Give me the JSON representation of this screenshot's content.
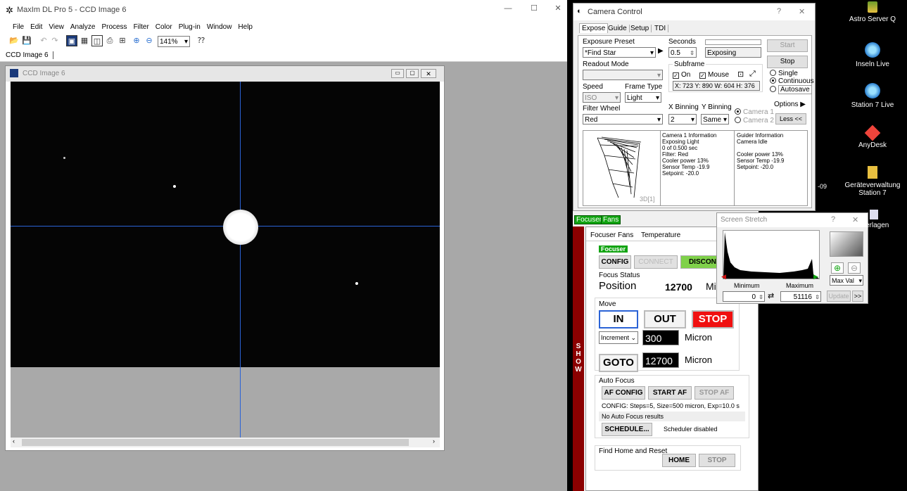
{
  "maxim": {
    "title": "MaxIm DL Pro 5 - CCD Image 6",
    "menu": [
      "File",
      "Edit",
      "View",
      "Analyze",
      "Process",
      "Filter",
      "Color",
      "Plug-in",
      "Window",
      "Help"
    ],
    "zoom": "141%",
    "tab": "CCD Image 6",
    "doc_title": "CCD Image 6"
  },
  "camera": {
    "title": "Camera Control",
    "tabs": [
      "Expose",
      "Guide",
      "Setup",
      "TDI"
    ],
    "exposure_preset_label": "Exposure Preset",
    "exposure_preset": "*Find Star",
    "seconds_label": "Seconds",
    "seconds": "0.5",
    "status": "Exposing",
    "start": "Start",
    "stop": "Stop",
    "readout_label": "Readout Mode",
    "subframe_label": "Subframe",
    "on_label": "On",
    "mouse_label": "Mouse",
    "subframe_coords": "X: 723 Y: 890 W: 604 H: 376",
    "single": "Single",
    "continuous": "Continuous",
    "autosave": "Autosave",
    "speed_label": "Speed",
    "speed": "ISO",
    "frame_type_label": "Frame Type",
    "frame_type": "Light",
    "options": "Options",
    "filter_label": "Filter Wheel",
    "filter": "Red",
    "xbin_label": "X Binning",
    "ybin_label": "Y Binning",
    "xbin": "2",
    "ybin": "Same",
    "camera1": "Camera 1",
    "camera2": "Camera 2",
    "less": "Less <<",
    "plot_label": "3D[1]",
    "info1": [
      "Camera 1 Information",
      "Exposing Light",
      "0 of 0.500 sec",
      "Filter: Red",
      "Cooler power 13%",
      "Sensor Temp -19.9",
      "Setpoint: -20.0"
    ],
    "info2": [
      "Guider Information",
      "Camera Idle",
      "",
      "Cooler power 13%",
      "Sensor Temp -19.9",
      "Setpoint: -20.0"
    ]
  },
  "focuser": {
    "outer_tabs": [
      "Focuser",
      "Fans"
    ],
    "tabs": [
      "Focuser",
      "Fans",
      "Temperature"
    ],
    "badge": "Focuser",
    "config": "CONFIG",
    "connect": "CONNECT",
    "disconnect": "DISCONNECT",
    "status_label": "Focus Status",
    "position_label": "Position",
    "position_value": "12700",
    "position_unit": "Micron",
    "move_label": "Move",
    "in": "IN",
    "out": "OUT",
    "stop": "STOP",
    "increment_mode": "Increment",
    "increment_value": "300",
    "increment_unit": "Micron",
    "goto": "GOTO",
    "goto_value": "12700",
    "goto_unit": "Micron",
    "af_label": "Auto Focus",
    "af_config": "AF CONFIG",
    "start_af": "START AF",
    "stop_af": "STOP AF",
    "af_config_text": "CONFIG: Steps=5, Size=500 micron, Exp=10.0 s",
    "af_results": "No Auto Focus results",
    "schedule": "SCHEDULE...",
    "scheduler_status": "Scheduler disabled",
    "home_label": "Find Home and Reset",
    "home": "HOME",
    "home_stop": "STOP",
    "show": "SHOW"
  },
  "stretch": {
    "title": "Screen Stretch",
    "min_label": "Minimum",
    "max_label": "Maximum",
    "min": "0",
    "max": "51116",
    "mode": "Max Val",
    "update": "Update",
    "more": ">>"
  },
  "desktop": [
    {
      "label": "Astro Server Q"
    },
    {
      "label": "Inseln Live"
    },
    {
      "label": "Station 7 Live"
    },
    {
      "label": "AnyDesk"
    },
    {
      "label": "Geräteverwaltung Station 7"
    },
    {
      "label": "erlagen"
    }
  ],
  "desktop_partial": "-09",
  "colors": {
    "accent": "#0078d7",
    "green": "#11a411",
    "red": "#f01010",
    "dark_red": "#8b0000"
  }
}
